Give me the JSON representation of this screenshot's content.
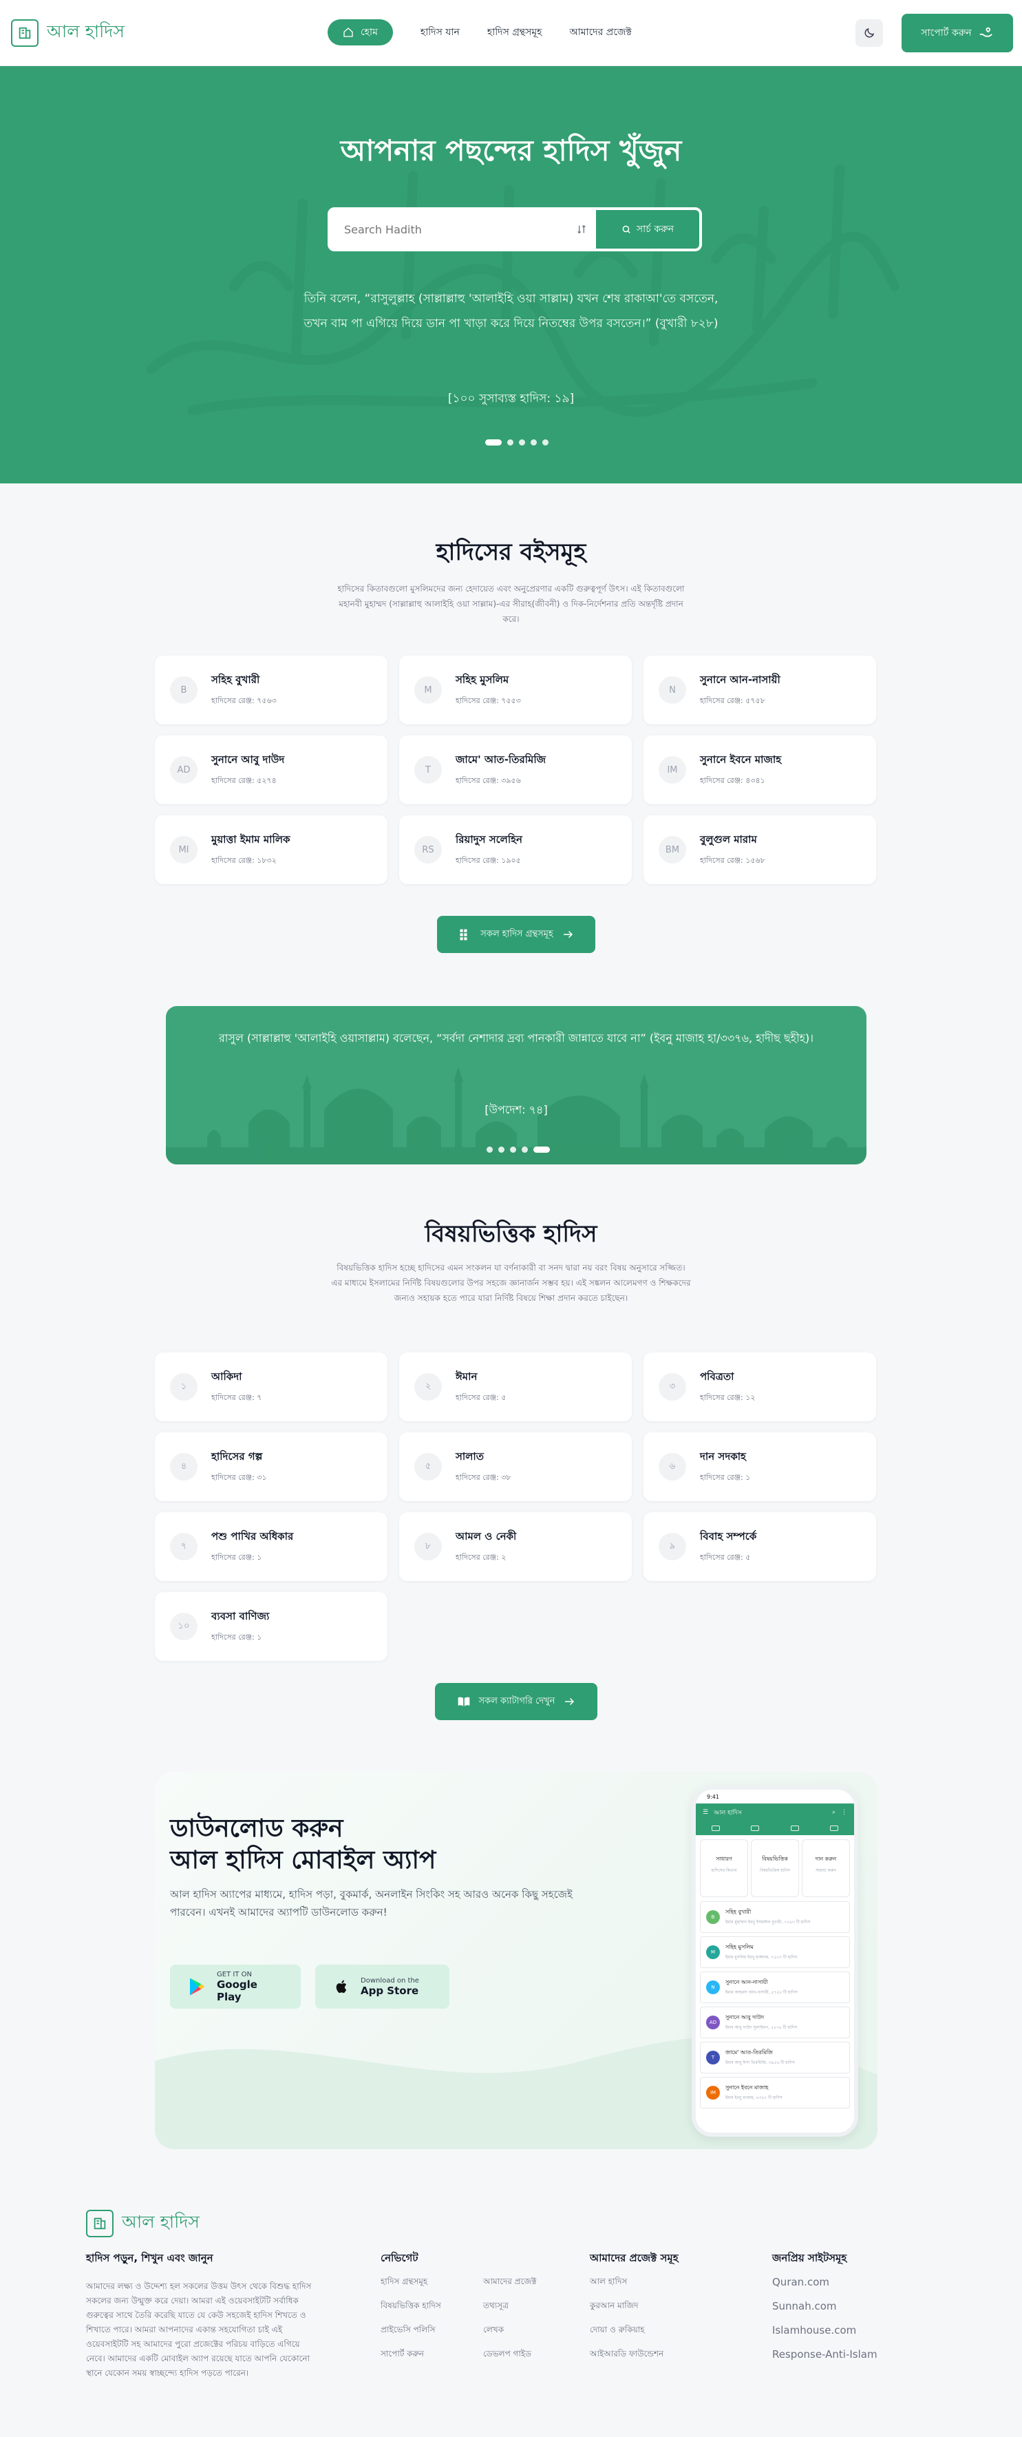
{
  "header": {
    "logo_text": "আল হাদিস",
    "nav": [
      "হোম",
      "হাদিস যান",
      "হাদিস গ্রন্থসমূহ",
      "আমাদের প্রজেক্ট"
    ],
    "support_label": "সাপোর্ট করুন"
  },
  "hero": {
    "title": "আপনার পছন্দের হাদিস খুঁজুন",
    "search_placeholder": "Search Hadith",
    "search_button": "সার্চ করুন",
    "quote": "তিনি বলেন, “রাসুলুল্লাহ (সাল্লাল্লাহু 'আলাইহি ওয়া সাল্লাম) যখন শেষ রাকাআ'তে বসতেন, তখন বাম পা এগিয়ে দিয়ে ডান পা খাড়া করে দিয়ে নিতম্বের উপর বসতেন।” (বুখারী ৮২৮)",
    "grade": "[১০০ সুসাব্যস্ত হাদিস: ১৯]"
  },
  "books": {
    "title": "হাদিসের বইসমূহ",
    "description": "হাদিসের কিতাবগুলো মুসলিমদের জন্য হেদায়েত এবং অনুপ্রেরণার একটি গুরুত্বপূর্ণ উৎস। এই কিতাবগুলো মহানবী মুহাম্মদ (সাল্লাল্লাহু আলাইহি ওয়া সাল্লাম)-এর সীরাহ(জীবনী) ও দিক-নির্দেশনার প্রতি অন্তর্দৃষ্টি প্রদান করে।",
    "items": [
      {
        "abbr": "B",
        "name": "সহিহ বুখারী",
        "count": "হাদিসের রেঞ্জ: ৭৫৬৩"
      },
      {
        "abbr": "M",
        "name": "সহিহ মুসলিম",
        "count": "হাদিসের রেঞ্জ: ৭৫৫৩"
      },
      {
        "abbr": "N",
        "name": "সুনানে আন-নাসায়ী",
        "count": "হাদিসের রেঞ্জ: ৫৭৫৮"
      },
      {
        "abbr": "AD",
        "name": "সুনানে আবু দাউদ",
        "count": "হাদিসের রেঞ্জ: ৫২৭৪"
      },
      {
        "abbr": "T",
        "name": "জামে' আত-তিরমিজি",
        "count": "হাদিসের রেঞ্জ: ৩৯৫৬"
      },
      {
        "abbr": "IM",
        "name": "সুনানে ইবনে মাজাহ",
        "count": "হাদিসের রেঞ্জ: ৪৩৪১"
      },
      {
        "abbr": "MI",
        "name": "মুয়াত্তা ইমাম মালিক",
        "count": "হাদিসের রেঞ্জ: ১৮৩২"
      },
      {
        "abbr": "RS",
        "name": "রিয়াদুস সলেহিন",
        "count": "হাদিসের রেঞ্জ: ১৯০৫"
      },
      {
        "abbr": "BM",
        "name": "বুলুগুল মারাম",
        "count": "হাদিসের রেঞ্জ: ১৫৬৮"
      }
    ],
    "all_button": "সকল হাদিস গ্রন্থসমূহ"
  },
  "banner": {
    "quote": "রাসুল (সাল্লাল্লাহু 'আলাইহি ওয়াসাল্লাম) বলেছেন, “সর্বদা নেশাদার দ্রব্য পানকারী জান্নাতে যাবে না” (ইবনু মাজাহ হা/৩৩৭৬, হাদীছ ছহীহ)।",
    "grade": "[উপদেশ: ৭৪]"
  },
  "topics": {
    "title": "বিষয়ভিত্তিক হাদিস",
    "description": "বিষয়ভিত্তিক হাদিস হচ্ছে হাদিসের এমন সংকলন যা বর্ণনাকারী বা সনদ দ্বারা নয় বরং বিষয় অনুসারে সজ্জিত। এর মাধ্যমে ইসলামের নির্দিষ্ট বিষয়গুলোর উপর সহজে জ্ঞানার্জন সম্ভব হয়। এই সঙ্কলন আলেমগণ ও শিক্ষকদের জন্যও সহায়ক হতে পারে যারা নির্দিষ্ট বিষয়ে শিক্ষা প্রদান করতে চাইছেন।",
    "items": [
      {
        "num": "১",
        "name": "আকিদা",
        "count": "হাদিসের রেঞ্জ: ৭"
      },
      {
        "num": "২",
        "name": "ঈমান",
        "count": "হাদিসের রেঞ্জ: ৫"
      },
      {
        "num": "৩",
        "name": "পবিত্রতা",
        "count": "হাদিসের রেঞ্জ: ১২"
      },
      {
        "num": "৪",
        "name": "হাদিসের গল্প",
        "count": "হাদিসের রেঞ্জ: ৩১"
      },
      {
        "num": "৫",
        "name": "সালাত",
        "count": "হাদিসের রেঞ্জ: ৩৮"
      },
      {
        "num": "৬",
        "name": "দান সদকাহ",
        "count": "হাদিসের রেঞ্জ: ১"
      },
      {
        "num": "৭",
        "name": "পশু পাখির অধিকার",
        "count": "হাদিসের রেঞ্জ: ১"
      },
      {
        "num": "৮",
        "name": "আমল ও নেকী",
        "count": "হাদিসের রেঞ্জ: ২"
      },
      {
        "num": "৯",
        "name": "বিবাহ সম্পর্কে",
        "count": "হাদিসের রেঞ্জ: ৫"
      },
      {
        "num": "১০",
        "name": "ব্যবসা বাণিজ্য",
        "count": "হাদিসের রেঞ্জ: ১"
      }
    ],
    "all_button": "সকল ক্যাটাগরি দেখুন"
  },
  "app": {
    "title_line1": "ডাউনলোড করুন",
    "title_line2": "আল হাদিস মোবাইল অ্যাপ",
    "description": "আল হাদিস অ্যাপের মাধ্যমে, হাদিস পড়া, বুকমার্ক, অনলাইন সিংকিং সহ আরও অনেক কিছু সহজেই পারবেন। এখনই আমাদের অ্যাপটি ডাউনলোড করুন!",
    "google_small": "GET IT ON",
    "google_big": "Google Play",
    "apple_small": "Download on the",
    "apple_big": "App Store",
    "phone": {
      "time": "9:41",
      "title": "আল হাদিস",
      "cats": [
        {
          "t": "সাধারণ",
          "s": "হাদিসের কিতাব"
        },
        {
          "t": "বিষয়ভিত্তিক",
          "s": "বিষয়ভিত্তিক হাদিস"
        },
        {
          "t": "দান করুন",
          "s": "সাহায্য করুন"
        }
      ],
      "books": [
        {
          "abbr": "B",
          "name": "সহিহ বুখারী",
          "sub": "ইমাম মুহাম্মাদ ইবনু ইসমাঈল বুখারী, ৭৫৬৩ টি হাদিস",
          "color": "#66bb6a"
        },
        {
          "abbr": "M",
          "name": "সহিহ মুসলিম",
          "sub": "ইমাম মুসলিম ইবনু হাজ্জাজ, ৭৫৫৩ টি হাদিস",
          "color": "#26a69a"
        },
        {
          "abbr": "N",
          "name": "সুনানে আন-নাসায়ী",
          "sub": "ইমাম আহমাদ আন-নাসায়ী, ৫৭৫৮ টি হাদিস",
          "color": "#29b6f6"
        },
        {
          "abbr": "AD",
          "name": "সুনানে আবু দাউদ",
          "sub": "ইমাম আবু দাউদ সুলাইমান, ৫২৭৪ টি হাদিস",
          "color": "#7e57c2"
        },
        {
          "abbr": "T",
          "name": "জামে' আত-তিরমিজি",
          "sub": "ইমাম আবু ঈসা তিরমিজি, ৩৯৫৬ টি হাদিস",
          "color": "#3f51b5"
        },
        {
          "abbr": "IM",
          "name": "সুনানে ইবনে মাজাহ",
          "sub": "ইমাম ইবনু মাজাহ, ৪৩৪১ টি হাদিস",
          "color": "#ef6c00"
        }
      ]
    }
  },
  "footer": {
    "logo_text": "আল হাদিস",
    "about_title": "হাদিস পড়ুন, শিখুন এবং জানুন",
    "about_text": "আমাদের লক্ষ্য ও উদ্দেশ্য হল সকলের উত্তম উৎস থেকে বিশুদ্ধ হাদিস সকলের জন্য উন্মুক্ত করে দেয়া। আমরা এই ওয়েবসাইটটি সর্বাধিক গুরুত্বের সাথে তৈরি করেছি যাতে যে কেউ সহজেই হাদিস শিখতে ও শিখাতে পারে। আমরা আপনাদের একান্ত সহযোগিতা চাই এই ওয়েবসাইটটি সহ আমাদের পুরো প্রজেক্টের পরিচয় বাড়িতে এগিয়ে নেবে। আমাদের একটি মোবাইল অ্যাপ রয়েছে যাতে আপনি যেকোনো স্থানে যেকোন সময় স্বাচ্ছন্দ্যে হাদিস পড়তে পারেন।",
    "nav_title": "নেভিগেট",
    "nav_links": [
      "হাদিস গ্রন্থসমূহ",
      "বিষয়ভিত্তিক হাদিস",
      "প্রাইভেসি পলিসি",
      "সাপোর্ট করুন"
    ],
    "nav_links2": [
      "আমাদের প্রজেক্ট",
      "তথ্যসূত্র",
      "লেখক",
      "ডেভলপ গাইড"
    ],
    "projects_title": "আমাদের প্রজেক্ট সমূহ",
    "projects": [
      "আল হাদিস",
      "কুরআন মাজিদ",
      "দোয়া ও রুকিয়াহ",
      "আইআরডি ফাউন্ডেশন"
    ],
    "sites_title": "জনপ্রিয় সাইটসমূহ",
    "sites": [
      "Quran.com",
      "Sunnah.com",
      "Islamhouse.com",
      "Response-Anti-Islam"
    ]
  }
}
